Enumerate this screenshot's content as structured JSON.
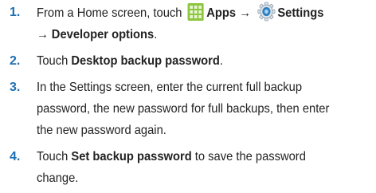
{
  "steps": [
    {
      "num": "1.",
      "pre": "From a Home screen, touch",
      "apps_label": "Apps",
      "arrow1": "→",
      "settings_label": "Settings",
      "line2": "→ Developer options",
      "end": "."
    },
    {
      "num": "2.",
      "pre": "Touch ",
      "bold": "Desktop backup password",
      "end": "."
    },
    {
      "num": "3.",
      "text": "In the Settings screen, enter the current full backup password, the new password for full backups, then enter the new password again."
    },
    {
      "num": "4.",
      "pre": "Touch ",
      "bold": "Set backup password",
      "post": " to save the password change."
    }
  ],
  "icons": {
    "apps": "apps-grid-icon",
    "settings": "settings-gear-icon"
  },
  "colors": {
    "step_number": "#1f6fb2",
    "text": "#222222",
    "apps_icon": "#8cc63f",
    "settings_icon": "#2f7fc1"
  }
}
